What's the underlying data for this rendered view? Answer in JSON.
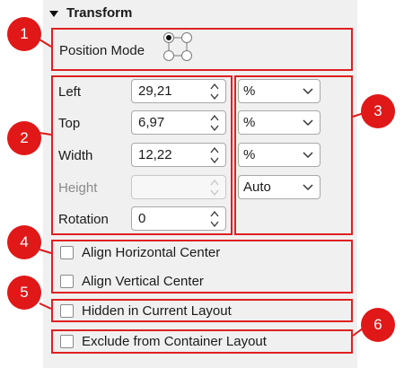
{
  "section": {
    "title": "Transform"
  },
  "position_mode": {
    "label": "Position Mode"
  },
  "fields": [
    {
      "label": "Left",
      "value": "29,21",
      "unit": "%"
    },
    {
      "label": "Top",
      "value": "6,97",
      "unit": "%"
    },
    {
      "label": "Width",
      "value": "12,22",
      "unit": "%"
    },
    {
      "label": "Height",
      "value": "",
      "unit": "Auto"
    },
    {
      "label": "Rotation",
      "value": "0"
    }
  ],
  "checkboxes": [
    {
      "label": "Align Horizontal Center",
      "checked": false
    },
    {
      "label": "Align Vertical Center",
      "checked": false
    },
    {
      "label": "Hidden in Current Layout",
      "checked": false
    },
    {
      "label": "Exclude from Container Layout",
      "checked": false
    }
  ],
  "callouts": [
    "1",
    "2",
    "3",
    "4",
    "5",
    "6"
  ],
  "colors": {
    "callout": "#e01818",
    "panel": "#f0f0f0"
  }
}
